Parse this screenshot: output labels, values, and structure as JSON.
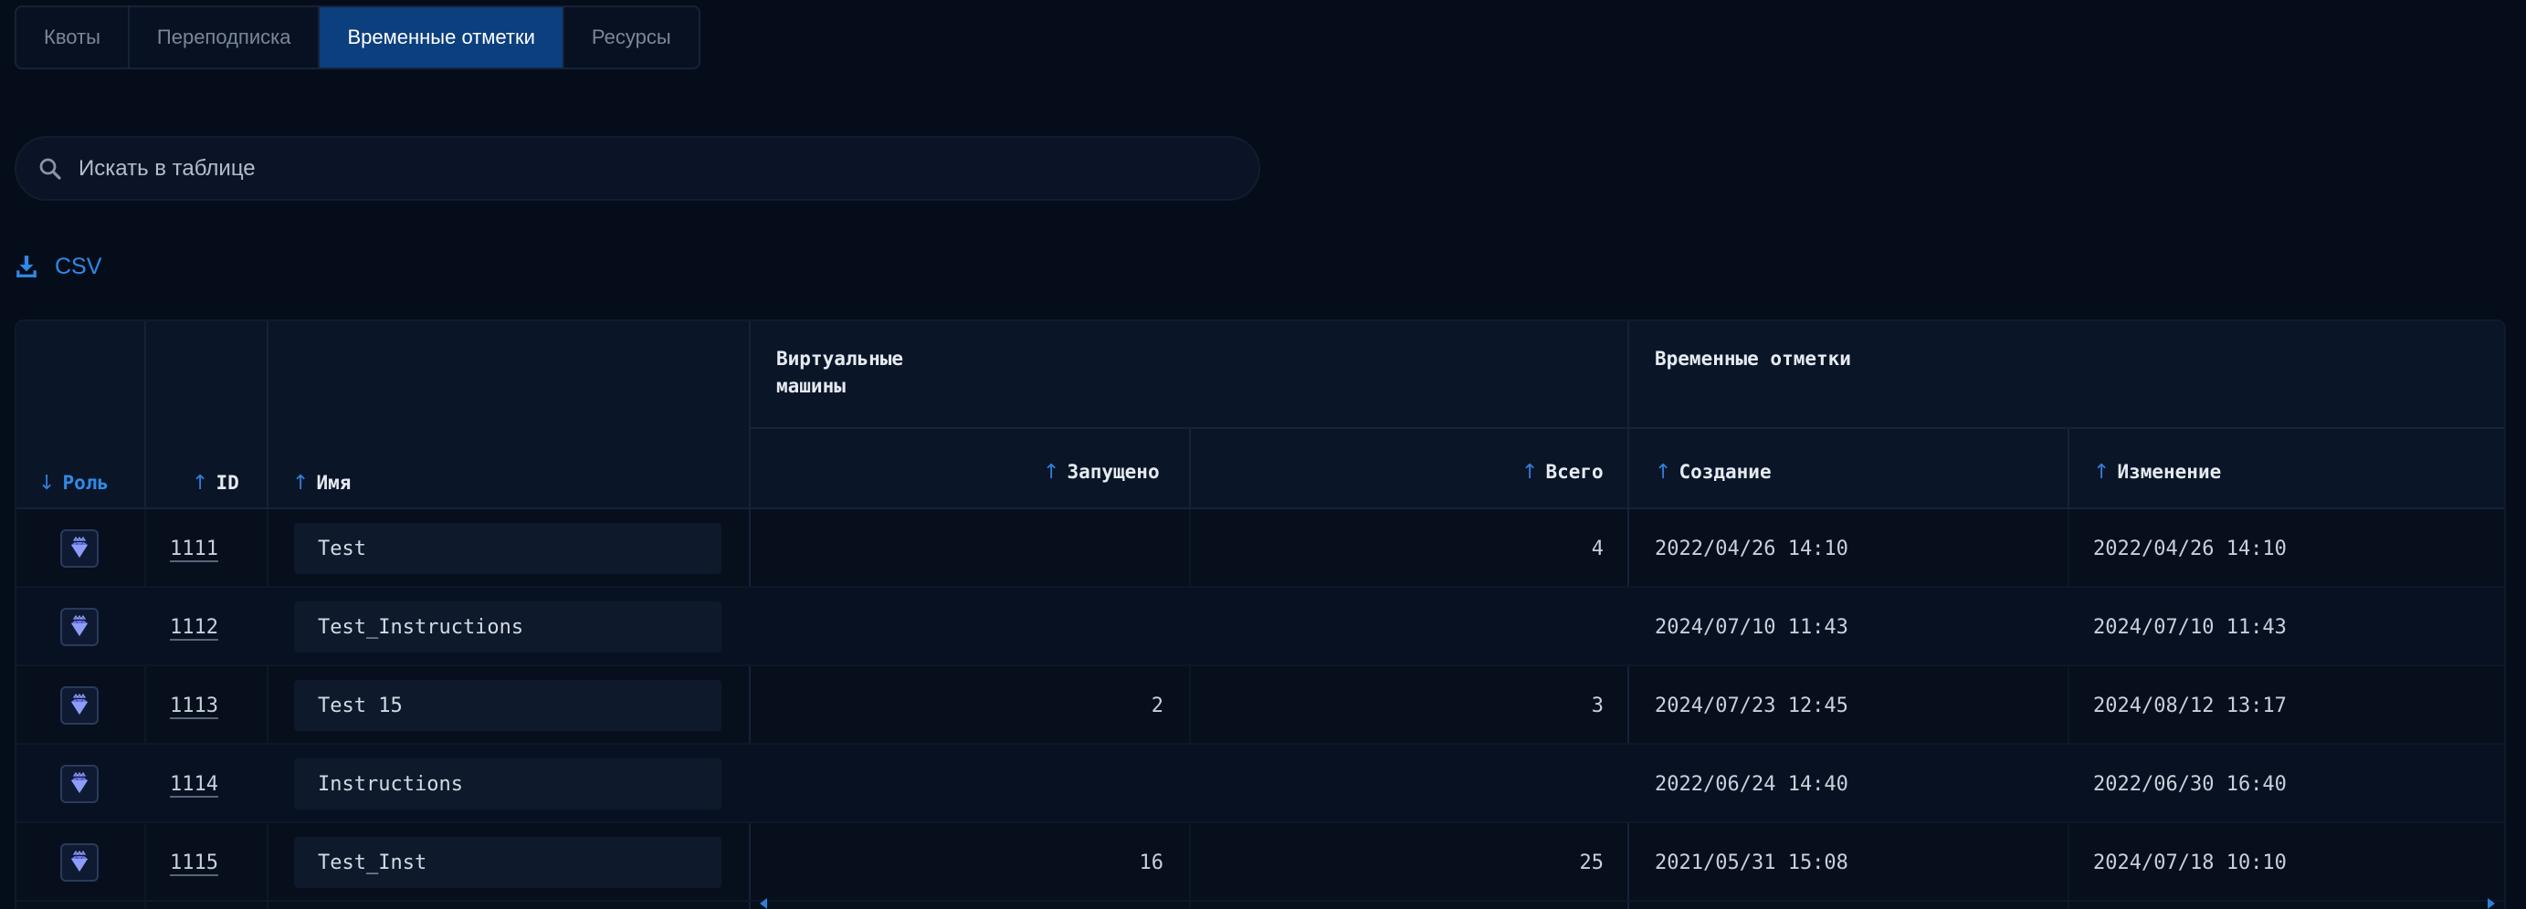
{
  "tabs": [
    {
      "label": "Квоты",
      "active": false
    },
    {
      "label": "Переподписка",
      "active": false
    },
    {
      "label": "Временные отметки",
      "active": true
    },
    {
      "label": "Ресурсы",
      "active": false
    }
  ],
  "search": {
    "placeholder": "Искать в таблице",
    "value": ""
  },
  "csv": {
    "label": "CSV"
  },
  "table": {
    "groups": {
      "vms": "Виртуальные\nмашины",
      "timestamps": "Временные отметки"
    },
    "columns": {
      "role": "Роль",
      "id": "ID",
      "name": "Имя",
      "running": "Запущено",
      "total": "Всего",
      "created": "Создание",
      "modified": "Изменение"
    },
    "rows": [
      {
        "role_icon": "diamond-crown-icon",
        "id": "1111",
        "name": "Test",
        "running": "",
        "total": "4",
        "created": "2022/04/26 14:10",
        "modified": "2022/04/26 14:10"
      },
      {
        "role_icon": "diamond-crown-icon",
        "id": "1112",
        "name": "Test_Instructions",
        "running": "",
        "total": "",
        "created": "2024/07/10 11:43",
        "modified": "2024/07/10 11:43"
      },
      {
        "role_icon": "diamond-crown-icon",
        "id": "1113",
        "name": "Test 15",
        "running": "2",
        "total": "3",
        "created": "2024/07/23 12:45",
        "modified": "2024/08/12 13:17"
      },
      {
        "role_icon": "diamond-crown-icon",
        "id": "1114",
        "name": "Instructions",
        "running": "",
        "total": "",
        "created": "2022/06/24 14:40",
        "modified": "2022/06/30 16:40"
      },
      {
        "role_icon": "diamond-crown-icon",
        "id": "1115",
        "name": "Test_Inst",
        "running": "16",
        "total": "25",
        "created": "2021/05/31 15:08",
        "modified": "2024/07/18 10:10"
      }
    ]
  },
  "colors": {
    "accent": "#2f8ae6",
    "active_tab": "#0c3f7e",
    "background": "#060d1a"
  }
}
